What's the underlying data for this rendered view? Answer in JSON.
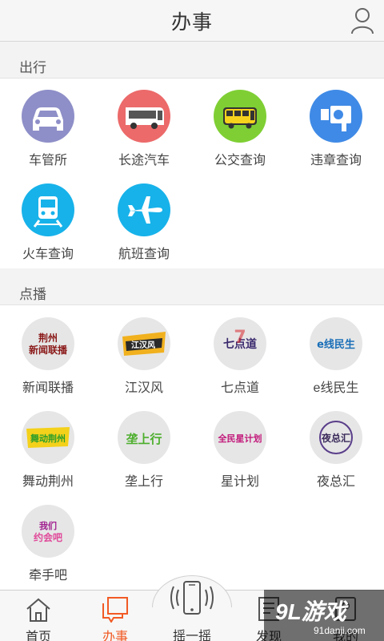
{
  "header": {
    "title": "办事"
  },
  "sections": {
    "travel": {
      "title": "出行",
      "items": [
        {
          "label": "车管所",
          "icon": "car-icon",
          "color": "#8e8fc8"
        },
        {
          "label": "长途汽车",
          "icon": "coach-bus-icon",
          "color": "#ec6a6a"
        },
        {
          "label": "公交查询",
          "icon": "bus-icon",
          "color": "#7fcf34"
        },
        {
          "label": "违章查询",
          "icon": "traffic-camera-icon",
          "color": "#3f8ae6"
        },
        {
          "label": "火车查询",
          "icon": "train-icon",
          "color": "#17b2ea"
        },
        {
          "label": "航班查询",
          "icon": "airplane-icon",
          "color": "#17b2ea"
        }
      ]
    },
    "vod": {
      "title": "点播",
      "items": [
        {
          "label": "新闻联播",
          "logo_text": "荆州新闻联播",
          "icon": "news-broadcast-logo"
        },
        {
          "label": "江汉风",
          "logo_text": "江汉风",
          "icon": "jianghanfeng-logo"
        },
        {
          "label": "七点道",
          "logo_text": "七点道",
          "icon": "qidiandao-logo"
        },
        {
          "label": "e线民生",
          "logo_text": "e线民生",
          "icon": "e-line-minsheng-logo"
        },
        {
          "label": "舞动荆州",
          "logo_text": "舞动荆州",
          "icon": "wudong-jingzhou-logo"
        },
        {
          "label": "垄上行",
          "logo_text": "垄上行",
          "icon": "longshangxing-logo"
        },
        {
          "label": "星计划",
          "logo_text": "全民星计划",
          "icon": "xingjihua-logo"
        },
        {
          "label": "夜总汇",
          "logo_text": "夜总汇",
          "icon": "yezonghui-logo"
        },
        {
          "label": "牵手吧",
          "logo_text": "我们约会吧",
          "icon": "qianshouba-logo"
        }
      ]
    }
  },
  "tabbar": {
    "items": [
      {
        "label": "首页",
        "icon": "home-icon"
      },
      {
        "label": "办事",
        "icon": "service-icon",
        "active": true
      },
      {
        "label": "摇一摇",
        "icon": "shake-phone-icon"
      },
      {
        "label": "发现",
        "icon": "discover-icon"
      },
      {
        "label": "我的",
        "icon": "profile-icon"
      }
    ]
  },
  "watermark": {
    "brand": "9L游戏",
    "domain": "91danji.com"
  },
  "colors": {
    "accent": "#f15a24",
    "header_bg": "#f6f6f6",
    "section_bg": "#f3f3f3"
  }
}
